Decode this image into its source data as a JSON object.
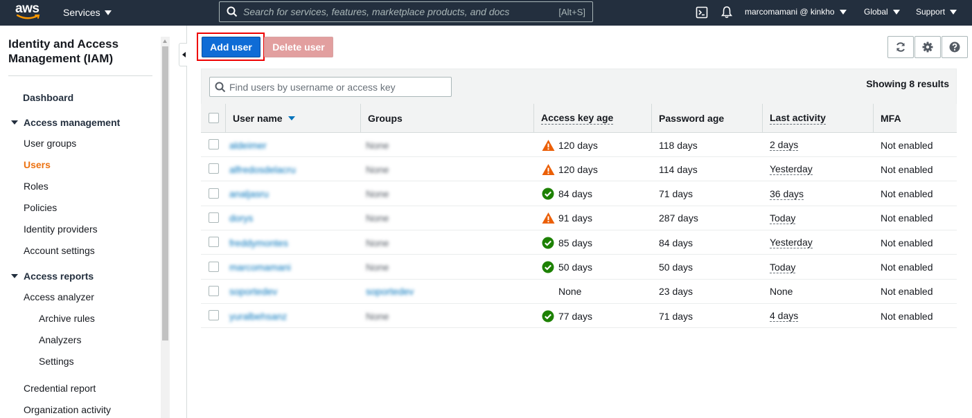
{
  "topnav": {
    "logo_text": "aws",
    "services_label": "Services",
    "search_placeholder": "Search for services, features, marketplace products, and docs",
    "search_shortcut": "[Alt+S]",
    "account_label": "marcomamani @ kinkho",
    "region_label": "Global",
    "support_label": "Support"
  },
  "sidebar": {
    "title": "Identity and Access Management (IAM)",
    "dashboard": "Dashboard",
    "access_management": {
      "label": "Access management",
      "items": [
        "User groups",
        "Users",
        "Roles",
        "Policies",
        "Identity providers",
        "Account settings"
      ],
      "active": "Users"
    },
    "access_reports": {
      "label": "Access reports",
      "access_analyzer": "Access analyzer",
      "analyzer_items": [
        "Archive rules",
        "Analyzers",
        "Settings"
      ],
      "credential_report": "Credential report",
      "organization_activity": "Organization activity"
    }
  },
  "toolbar": {
    "add_user_label": "Add user",
    "delete_user_label": "Delete user",
    "refresh_icon": "refresh-icon",
    "settings_icon": "gear-icon",
    "help_icon": "help-icon"
  },
  "table": {
    "filter_placeholder": "Find users by username or access key",
    "results_label": "Showing 8 results",
    "columns": [
      "User name",
      "Groups",
      "Access key age",
      "Password age",
      "Last activity",
      "MFA"
    ],
    "sort_column": "User name",
    "rows": [
      {
        "username": "aldeimer",
        "groups": "None",
        "key_status": "warning",
        "key_age": "120 days",
        "password_age": "118 days",
        "last_activity": "2 days",
        "mfa": "Not enabled",
        "group_link": false
      },
      {
        "username": "alfredosdelacru",
        "groups": "None",
        "key_status": "warning",
        "key_age": "120 days",
        "password_age": "114 days",
        "last_activity": "Yesterday",
        "mfa": "Not enabled",
        "group_link": false
      },
      {
        "username": "analjasru",
        "groups": "None",
        "key_status": "ok",
        "key_age": "84 days",
        "password_age": "71 days",
        "last_activity": "36 days",
        "mfa": "Not enabled",
        "group_link": false
      },
      {
        "username": "dorys",
        "groups": "None",
        "key_status": "warning",
        "key_age": "91 days",
        "password_age": "287 days",
        "last_activity": "Today",
        "mfa": "Not enabled",
        "group_link": false
      },
      {
        "username": "freddymontes",
        "groups": "None",
        "key_status": "ok",
        "key_age": "85 days",
        "password_age": "84 days",
        "last_activity": "Yesterday",
        "mfa": "Not enabled",
        "group_link": false
      },
      {
        "username": "marcomamani",
        "groups": "None",
        "key_status": "ok",
        "key_age": "50 days",
        "password_age": "50 days",
        "last_activity": "Today",
        "mfa": "Not enabled",
        "group_link": false
      },
      {
        "username": "soportedev",
        "groups": "soportedev",
        "key_status": "none",
        "key_age": "None",
        "password_age": "23 days",
        "last_activity": "None",
        "mfa": "Not enabled",
        "group_link": true
      },
      {
        "username": "yuralbehsanz",
        "groups": "None",
        "key_status": "ok",
        "key_age": "77 days",
        "password_age": "71 days",
        "last_activity": "4 days",
        "mfa": "Not enabled",
        "group_link": false
      }
    ]
  },
  "colors": {
    "nav_bg": "#232f3e",
    "primary": "#0f6cd6",
    "active_nav": "#ec7211",
    "warning": "#eb5f07",
    "success": "#1d8102",
    "link": "#0073bb"
  }
}
